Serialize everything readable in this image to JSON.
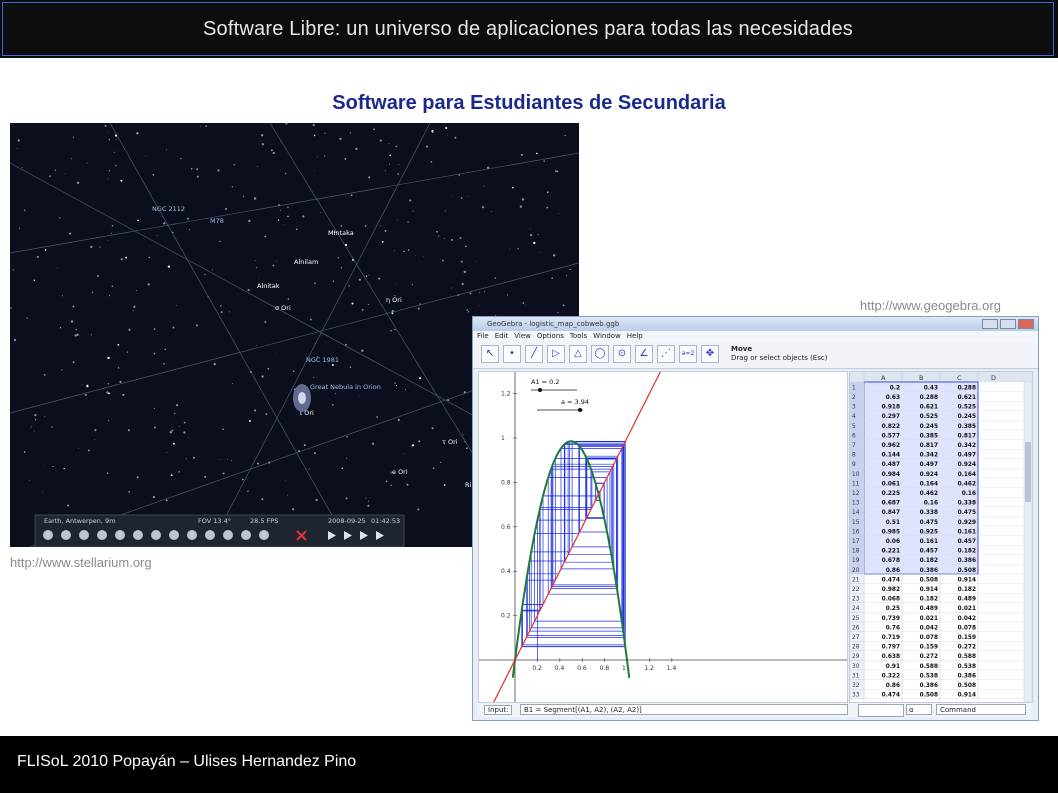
{
  "header": {
    "title": "Software Libre: un universo de aplicaciones para todas las necesidades"
  },
  "slide": {
    "title": "Software para Estudiantes de Secundaria"
  },
  "stellarium": {
    "url": "http://www.stellarium.org",
    "labels": [
      "NGC 2112",
      "M78",
      "Mintaka",
      "Alnilam",
      "Alnitak",
      "σ Ori",
      "η Ori",
      "NGC 1981",
      "Great Nebula in Orion",
      "ι Ori",
      "τ Ori",
      "e Ori",
      "Ri"
    ],
    "statusbar": {
      "location": "Earth, Antwerpen, 9m",
      "fov": "FOV 13.4°",
      "fps": "28.5 FPS",
      "date": "2008-09-25",
      "time": "01:42:53"
    }
  },
  "geogebra": {
    "url": "http://www.geogebra.org",
    "window_title": "GeoGebra - logistic_map_cobweb.ggb",
    "menu": [
      "File",
      "Edit",
      "View",
      "Options",
      "Tools",
      "Window",
      "Help"
    ],
    "mode_title": "Move",
    "mode_hint": "Drag or select objects (Esc)",
    "sliders": [
      "A1 = 0.2",
      "a = 3.94"
    ],
    "y_ticks": [
      "1.2",
      "1",
      "0.8",
      "0.6",
      "0.4",
      "0.2"
    ],
    "x_ticks": [
      "0.2",
      "0.4",
      "0.6",
      "0.8",
      "1",
      "1.2",
      "1.4"
    ],
    "sheet_columns": [
      "A",
      "B",
      "C",
      "D"
    ],
    "sheet_rows": [
      [
        "1",
        "0.2",
        "0.43",
        "0.288"
      ],
      [
        "2",
        "0.63",
        "0.288",
        "0.621"
      ],
      [
        "3",
        "0.918",
        "0.621",
        "0.525"
      ],
      [
        "4",
        "0.297",
        "0.525",
        "0.245"
      ],
      [
        "5",
        "0.822",
        "0.245",
        "0.385"
      ],
      [
        "6",
        "0.577",
        "0.385",
        "0.817"
      ],
      [
        "7",
        "0.962",
        "0.817",
        "0.342"
      ],
      [
        "8",
        "0.144",
        "0.342",
        "0.497"
      ],
      [
        "9",
        "0.487",
        "0.497",
        "0.924"
      ],
      [
        "10",
        "0.984",
        "0.924",
        "0.164"
      ],
      [
        "11",
        "0.061",
        "0.164",
        "0.462"
      ],
      [
        "12",
        "0.225",
        "0.462",
        "0.16"
      ],
      [
        "13",
        "0.687",
        "0.16",
        "0.338"
      ],
      [
        "14",
        "0.847",
        "0.338",
        "0.475"
      ],
      [
        "15",
        "0.51",
        "0.475",
        "0.929"
      ],
      [
        "16",
        "0.985",
        "0.925",
        "0.161"
      ],
      [
        "17",
        "0.06",
        "0.161",
        "0.457"
      ],
      [
        "18",
        "0.221",
        "0.457",
        "0.182"
      ],
      [
        "19",
        "0.678",
        "0.182",
        "0.386"
      ],
      [
        "20",
        "0.86",
        "0.386",
        "0.508"
      ],
      [
        "21",
        "0.474",
        "0.508",
        "0.914"
      ],
      [
        "22",
        "0.982",
        "0.914",
        "0.182"
      ],
      [
        "23",
        "0.068",
        "0.182",
        "0.489"
      ],
      [
        "24",
        "0.25",
        "0.489",
        "0.021"
      ],
      [
        "25",
        "0.739",
        "0.021",
        "0.042"
      ],
      [
        "26",
        "0.76",
        "0.042",
        "0.078"
      ],
      [
        "27",
        "0.719",
        "0.078",
        "0.159"
      ],
      [
        "28",
        "0.797",
        "0.159",
        "0.272"
      ],
      [
        "29",
        "0.638",
        "0.272",
        "0.588"
      ],
      [
        "30",
        "0.91",
        "0.588",
        "0.538"
      ],
      [
        "31",
        "0.322",
        "0.538",
        "0.386"
      ],
      [
        "32",
        "0.86",
        "0.386",
        "0.508"
      ],
      [
        "33",
        "0.474",
        "0.508",
        "0.914"
      ]
    ],
    "input_label": "Input:",
    "input_value": "B1 = Segment[(A1, A2), (A2, A2)]",
    "command_label": "Command"
  },
  "footer": {
    "text": "FLISoL 2010 Popayán – Ulises Hernandez Pino"
  },
  "colors": {
    "title_blue": "#1a2a8c",
    "link_gray": "#8a8a8a",
    "parabola": "#1f7a3a",
    "diagonal": "#e03030",
    "cobweb": "#1f2fe0"
  }
}
